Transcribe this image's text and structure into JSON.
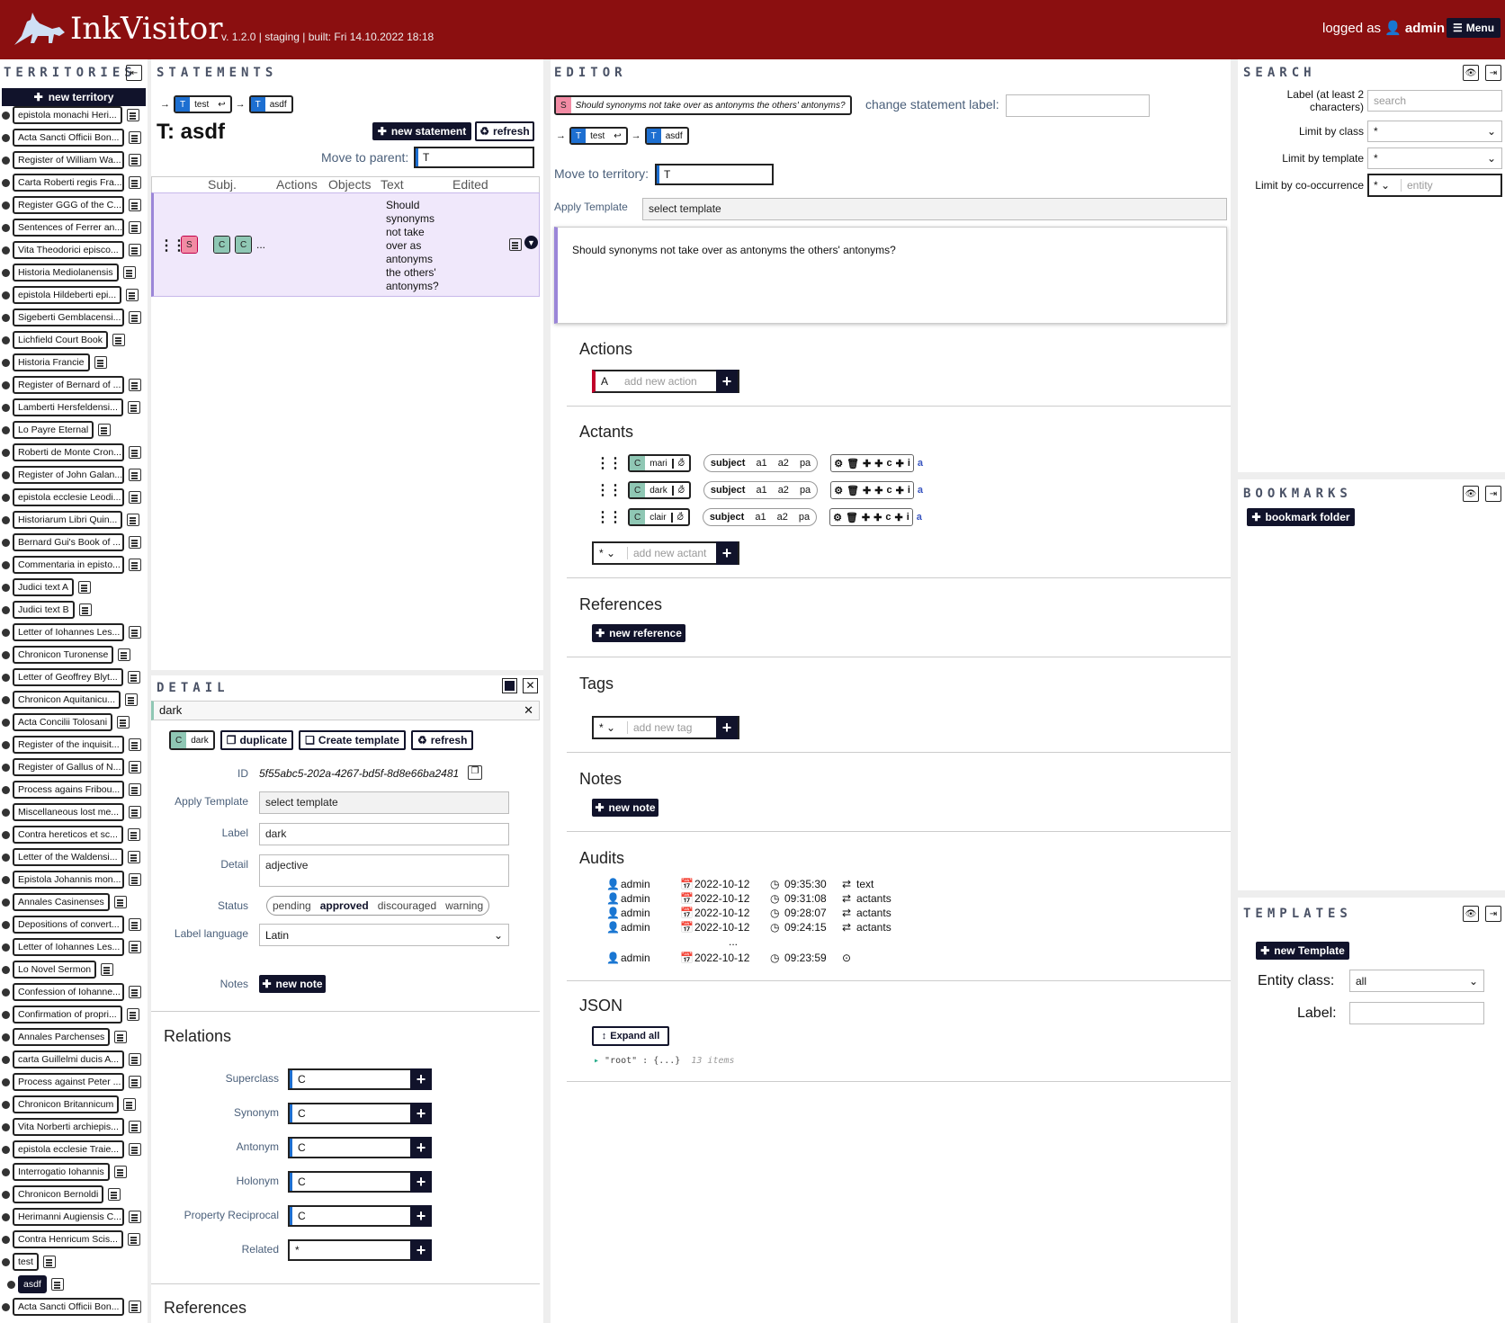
{
  "header": {
    "app_title": "InkVisitor",
    "version": "v. 1.2.0 | staging | built: Fri 14.10.2022 18:18",
    "logged_as": "logged as",
    "username": "admin",
    "menu_label": "Menu"
  },
  "panels": {
    "territories": "TERRITORIES",
    "statements": "STATEMENTS",
    "editor": "EDITOR",
    "search": "SEARCH",
    "bookmarks": "BOOKMARKS",
    "templates": "TEMPLATES",
    "detail": "DETAIL"
  },
  "territories": {
    "new_label": "new territory",
    "items": [
      "epistola monachi Heri...",
      "Acta Sancti Officii Bon...",
      "Register of William Wa...",
      "Carta Roberti regis Fra...",
      "Register GGG of the C...",
      "Sentences of Ferrer an...",
      "Vita Theodorici episco...",
      "Historia Mediolanensis",
      "epistola Hildeberti epi...",
      "Sigeberti Gemblacensi...",
      "Lichfield Court Book",
      "Historia Francie",
      "Register of Bernard of ...",
      "Lamberti Hersfeldensi...",
      "Lo Payre Eternal",
      "Roberti de Monte Cron...",
      "Register of John Galan...",
      "epistola ecclesie Leodi...",
      "Historiarum Libri Quin...",
      "Bernard Gui's Book of ...",
      "Commentaria in episto...",
      "Judici text A",
      "Judici text B",
      "Letter of Iohannes Les...",
      "Chronicon Turonense",
      "Letter of Geoffrey Blyt...",
      "Chronicon Aquitanicu...",
      "Acta Concilii Tolosani",
      "Register of the inquisit...",
      "Register of Gallus of N...",
      "Process agains Fribou...",
      "Miscellaneous lost me...",
      "Contra hereticos et sc...",
      "Letter of the Waldensi...",
      "Epistola Johannis mon...",
      "Annales Casinenses",
      "Depositions of convert...",
      "Letter of Iohannes Les...",
      "Lo Novel Sermon",
      "Confession of Iohanne...",
      "Confirmation of propri...",
      "Annales Parchenses",
      "carta Guillelmi ducis A...",
      "Process against Peter ...",
      "Chronicon Britannicum",
      "Vita Norberti archiepis...",
      "epistola ecclesie Traie...",
      "Interrogatio Iohannis",
      "Chronicon Bernoldi",
      "Herimanni Augiensis C...",
      "Contra Henricum Scis...",
      "test",
      "asdf",
      "Acta Sancti Officii Bon..."
    ]
  },
  "statements": {
    "breadcrumb": [
      {
        "type": "T",
        "label": "test"
      },
      {
        "type": "T",
        "label": "asdf"
      }
    ],
    "title": "T: asdf",
    "new_statement": "new statement",
    "refresh": "refresh",
    "move_to_parent": "Move to parent:",
    "move_prefix": "T",
    "columns": [
      "Subj.",
      "Actions",
      "Objects",
      "Text",
      "Edited"
    ],
    "row": {
      "subject": "S",
      "objects": [
        "C",
        "C"
      ],
      "ellipsis": "...",
      "text": "Should synonyms not take over as antonyms the others' antonyms?"
    }
  },
  "detail": {
    "tab": "dark",
    "entity": {
      "type": "C",
      "label": "dark"
    },
    "duplicate": "duplicate",
    "create_template": "Create template",
    "refresh": "refresh",
    "id_label": "ID",
    "id_value": "5f55abc5-202a-4267-bd5f-8d8e66ba2481",
    "apply_template_label": "Apply Template",
    "apply_template_value": "select template",
    "label_label": "Label",
    "label_value": "dark",
    "detail_label": "Detail",
    "detail_value": "adjective",
    "status_label": "Status",
    "status_options": [
      "pending",
      "approved",
      "discouraged",
      "warning"
    ],
    "status_selected": "approved",
    "language_label": "Label language",
    "language_value": "Latin",
    "notes_label": "Notes",
    "new_note": "new note",
    "relations_title": "Relations",
    "relations": [
      "Superclass",
      "Synonym",
      "Antonym",
      "Holonym",
      "Property Reciprocal",
      "Related"
    ],
    "relation_prefix": "C",
    "related_prefix": "*",
    "references_title": "References"
  },
  "editor": {
    "statement_chip": {
      "type": "S",
      "label": "Should synonyms not take over as antonyms the others' antonyms?"
    },
    "change_label": "change statement label:",
    "breadcrumb": [
      {
        "type": "T",
        "label": "test"
      },
      {
        "type": "T",
        "label": "asdf"
      }
    ],
    "move_to_territory": "Move to territory:",
    "move_prefix": "T",
    "apply_template_label": "Apply Template",
    "apply_template_value": "select template",
    "text": "Should synonyms not take over as antonyms the others' antonyms?",
    "actions_title": "Actions",
    "action_prefix": "A",
    "action_placeholder": "add new action",
    "actants_title": "Actants",
    "actants": [
      {
        "type": "C",
        "label": "mari"
      },
      {
        "type": "C",
        "label": "dark"
      },
      {
        "type": "C",
        "label": "clair"
      }
    ],
    "actant_position": "subject",
    "actant_extra": [
      "a1",
      "a2",
      "pa"
    ],
    "actant_tools_letters": [
      "c",
      "i"
    ],
    "actant_a": "a",
    "actant_prefix": "*",
    "actant_placeholder": "add new actant",
    "references_title": "References",
    "new_reference": "new reference",
    "tags_title": "Tags",
    "tag_prefix": "*",
    "tag_placeholder": "add new tag",
    "notes_title": "Notes",
    "new_note": "new note",
    "audits_title": "Audits",
    "audits": [
      {
        "user": "admin",
        "date": "2022-10-12",
        "time": "09:35:30",
        "what": "text"
      },
      {
        "user": "admin",
        "date": "2022-10-12",
        "time": "09:31:08",
        "what": "actants"
      },
      {
        "user": "admin",
        "date": "2022-10-12",
        "time": "09:28:07",
        "what": "actants"
      },
      {
        "user": "admin",
        "date": "2022-10-12",
        "time": "09:24:15",
        "what": "actants"
      }
    ],
    "audit_more": "...",
    "audit_created": {
      "user": "admin",
      "date": "2022-10-12",
      "time": "09:23:59"
    },
    "json_title": "JSON",
    "expand_all": "Expand all",
    "json_root": "\"root\" : {...}",
    "json_count": "13 items"
  },
  "search": {
    "label_label": "Label (at least 2 characters)",
    "label_placeholder": "search",
    "class_label": "Limit by class",
    "class_value": "*",
    "template_label": "Limit by template",
    "template_value": "*",
    "cooc_label": "Limit by co-occurrence",
    "cooc_value": "*",
    "cooc_placeholder": "entity"
  },
  "bookmarks": {
    "folder": "bookmark folder"
  },
  "templates": {
    "new": "new Template",
    "entity_class_label": "Entity class:",
    "entity_class_value": "all",
    "label_label": "Label:"
  },
  "colors": {
    "header": "#8b0f10",
    "dark": "#11132b",
    "territory": "#1d6fd1",
    "statement": "#f28ba4",
    "concept": "#8fc7b4",
    "action": "#c0002a"
  }
}
